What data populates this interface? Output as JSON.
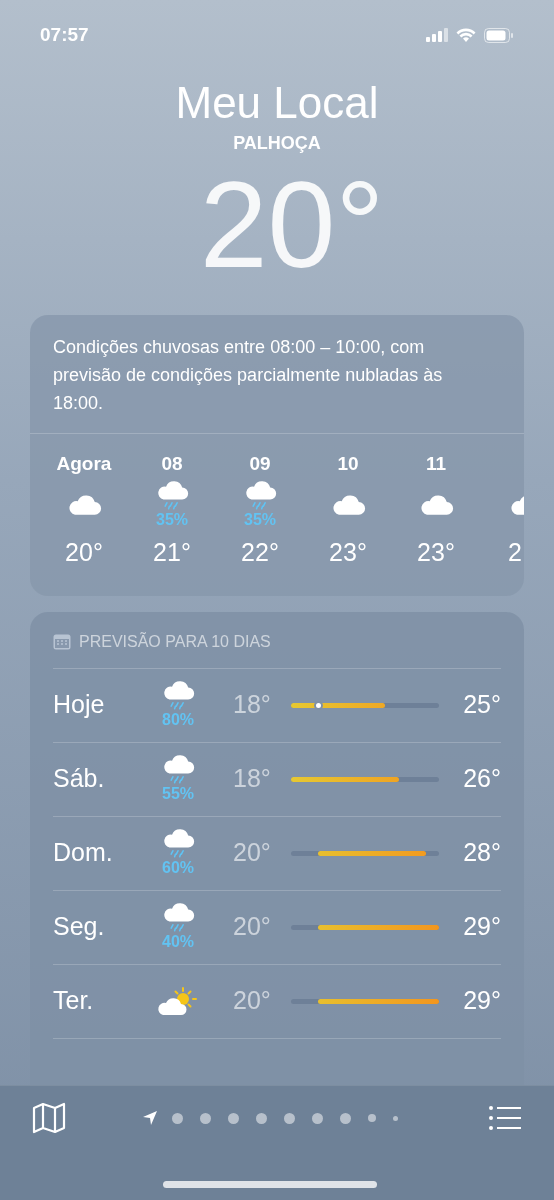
{
  "status_bar": {
    "time": "07:57"
  },
  "header": {
    "title": "Meu Local",
    "location": "PALHOÇA",
    "temperature": "20°"
  },
  "hourly": {
    "summary": "Condições chuvosas entre 08:00 – 10:00, com previsão de condições parcialmente nubladas às 18:00.",
    "hours": [
      {
        "label": "Agora",
        "kind": "cloud",
        "temp": "20°"
      },
      {
        "label": "08",
        "kind": "rain",
        "chance": "35%",
        "temp": "21°"
      },
      {
        "label": "09",
        "kind": "rain",
        "chance": "35%",
        "temp": "22°"
      },
      {
        "label": "10",
        "kind": "cloud",
        "temp": "23°"
      },
      {
        "label": "11",
        "kind": "cloud",
        "temp": "23°"
      },
      {
        "kind": "cloud",
        "temp": "2"
      }
    ]
  },
  "forecast": {
    "title": "PREVISÃO PARA 10 DIAS",
    "days": [
      {
        "day": "Hoje",
        "kind": "rain",
        "chance": "80%",
        "low": "18°",
        "high": "25°",
        "level": 0.18
      },
      {
        "day": "Sáb.",
        "kind": "rain",
        "chance": "55%",
        "low": "18°",
        "high": "26°"
      },
      {
        "day": "Dom.",
        "kind": "rain",
        "chance": "60%",
        "low": "20°",
        "high": "28°"
      },
      {
        "day": "Seg.",
        "kind": "rain",
        "chance": "40%",
        "low": "20°",
        "high": "29°"
      },
      {
        "day": "Ter.",
        "kind": "sun-cloud",
        "low": "20°",
        "high": "29°"
      }
    ]
  }
}
